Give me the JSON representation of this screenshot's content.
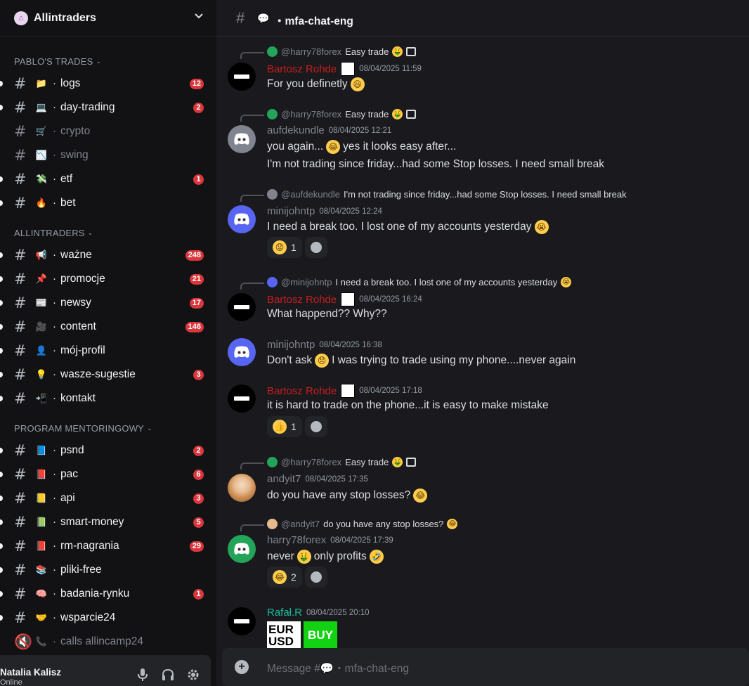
{
  "server": {
    "name": "Allintraders"
  },
  "categories": [
    {
      "label": "PABLO'S TRADES"
    },
    {
      "label": "ALLINTRADERS"
    },
    {
      "label": "PROGRAM MENTORINGOWY"
    }
  ],
  "channels": [
    {
      "name": "logs",
      "emoji": "📁",
      "badge": "12",
      "unread": true
    },
    {
      "name": "day-trading",
      "emoji": "💻",
      "badge": "2",
      "unread": true
    },
    {
      "name": "crypto",
      "emoji": "🛒",
      "badge": "",
      "unread": false
    },
    {
      "name": "swing",
      "emoji": "📉",
      "badge": "",
      "unread": false
    },
    {
      "name": "etf",
      "emoji": "💸",
      "badge": "1",
      "unread": true
    },
    {
      "name": "bet",
      "emoji": "🔥",
      "badge": "",
      "unread": true
    },
    {
      "name": "ważne",
      "emoji": "📢",
      "badge": "248",
      "unread": true
    },
    {
      "name": "promocje",
      "emoji": "📌",
      "badge": "21",
      "unread": true
    },
    {
      "name": "newsy",
      "emoji": "📰",
      "badge": "17",
      "unread": true
    },
    {
      "name": "content",
      "emoji": "🎥",
      "badge": "146",
      "unread": true
    },
    {
      "name": "mój-profil",
      "emoji": "👤",
      "badge": "",
      "unread": true
    },
    {
      "name": "wasze-sugestie",
      "emoji": "💡",
      "badge": "3",
      "unread": true
    },
    {
      "name": "kontakt",
      "emoji": "📲",
      "badge": "",
      "unread": true
    },
    {
      "name": "psnd",
      "emoji": "📘",
      "badge": "2",
      "unread": true
    },
    {
      "name": "pac",
      "emoji": "📕",
      "badge": "6",
      "unread": true
    },
    {
      "name": "api",
      "emoji": "📒",
      "badge": "3",
      "unread": true
    },
    {
      "name": "smart-money",
      "emoji": "📗",
      "badge": "5",
      "unread": true
    },
    {
      "name": "rm-nagrania",
      "emoji": "📕",
      "badge": "29",
      "unread": true
    },
    {
      "name": "pliki-free",
      "emoji": "📚",
      "badge": "",
      "unread": true
    },
    {
      "name": "badania-rynku",
      "emoji": "🧠",
      "badge": "1",
      "unread": true
    },
    {
      "name": "wsparcie24",
      "emoji": "🤝",
      "badge": "",
      "unread": true
    },
    {
      "name": "calls allincamp24",
      "emoji": "📞",
      "badge": "",
      "unread": false
    }
  ],
  "user": {
    "name": "Natalia Kalisz",
    "status": "Online"
  },
  "header": {
    "channel": "mfa-chat-eng"
  },
  "messages": [
    {
      "reply": {
        "mention": "@harry78forex",
        "text": "Easy trade"
      },
      "author": "Bartosz Rohde",
      "author_color": "#c81d1d",
      "ts": "08/04/2025 11:59",
      "text": "For you definetly"
    },
    {
      "reply": {
        "mention": "@harry78forex",
        "text": "Easy trade"
      },
      "author": "aufdekundle",
      "author_color": "#80848e",
      "ts": "08/04/2025 12:21",
      "text": "you again...",
      "text_b": "yes it looks easy after...",
      "text2": "I'm not trading since friday...had some Stop losses. I need small break"
    },
    {
      "reply": {
        "mention": "@aufdekundle",
        "text": "I'm not trading since friday...had some Stop losses. I need small break"
      },
      "author": "minijohntp",
      "author_color": "#80848e",
      "ts": "08/04/2025 12:24",
      "text": "I need a break too. I lost one of my accounts yesterday",
      "reaction": "1"
    },
    {
      "reply": {
        "mention": "@minijohntp",
        "text": "I need a break too. I lost one of my accounts yesterday"
      },
      "author": "Bartosz Rohde",
      "author_color": "#c81d1d",
      "ts": "08/04/2025 16:24",
      "text": "What happend?? Why??"
    },
    {
      "author": "minijohntp",
      "author_color": "#80848e",
      "ts": "08/04/2025 16:38",
      "text": "Don't ask",
      "text_b": "I was trying to trade using my phone....never again"
    },
    {
      "author": "Bartosz Rohde",
      "author_color": "#c81d1d",
      "ts": "08/04/2025 17:18",
      "text": "it is hard to trade on the phone...it is easy to make mistake",
      "reaction": "1"
    },
    {
      "reply": {
        "mention": "@harry78forex",
        "text": "Easy trade"
      },
      "author": "andyit7",
      "author_color": "#80848e",
      "ts": "08/04/2025 17:35",
      "text": "do you have any stop losses?"
    },
    {
      "reply": {
        "mention": "@andyit7",
        "text": "do you have any stop losses?"
      },
      "author": "harry78forex",
      "author_color": "#80848e",
      "ts": "08/04/2025 17:39",
      "text": "never",
      "text_b": "only profits",
      "reaction": "2"
    },
    {
      "author": "Rafał.R",
      "author_color": "#1abc9c",
      "ts": "08/04/2025 20:10",
      "image1": "EUR USD",
      "image2": "BUY"
    }
  ],
  "composer": {
    "placeholder": "Message #💬・mfa-chat-eng"
  }
}
